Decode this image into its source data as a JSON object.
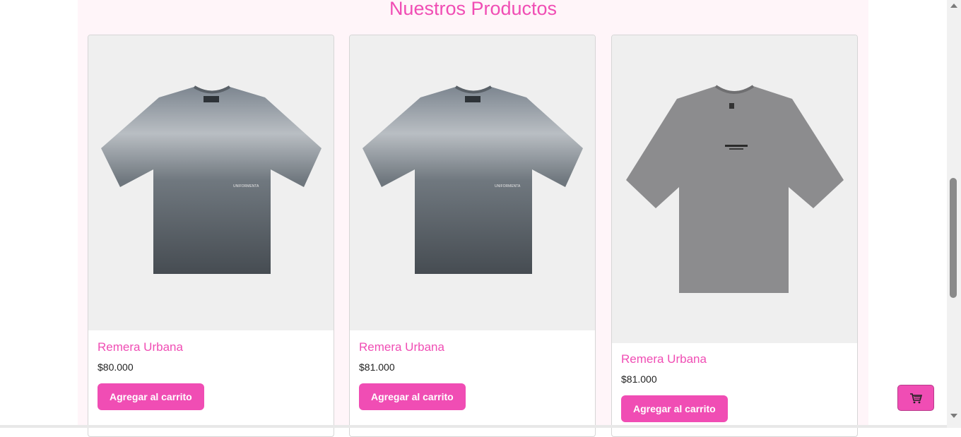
{
  "section": {
    "title": "Nuestros Productos"
  },
  "products": [
    {
      "name": "Remera Urbana",
      "price": "$80.000",
      "button": "Agregar al carrito",
      "image_icon": "tshirt-gradient-icon"
    },
    {
      "name": "Remera Urbana",
      "price": "$81.000",
      "button": "Agregar al carrito",
      "image_icon": "tshirt-gradient-icon"
    },
    {
      "name": "Remera Urbana",
      "price": "$81.000",
      "button": "Agregar al carrito",
      "image_icon": "tshirt-gray-icon"
    }
  ],
  "cart": {
    "icon": "cart-icon"
  },
  "colors": {
    "accent": "#f04db4",
    "section_bg": "#fff5f9",
    "image_bg": "#efefef"
  }
}
